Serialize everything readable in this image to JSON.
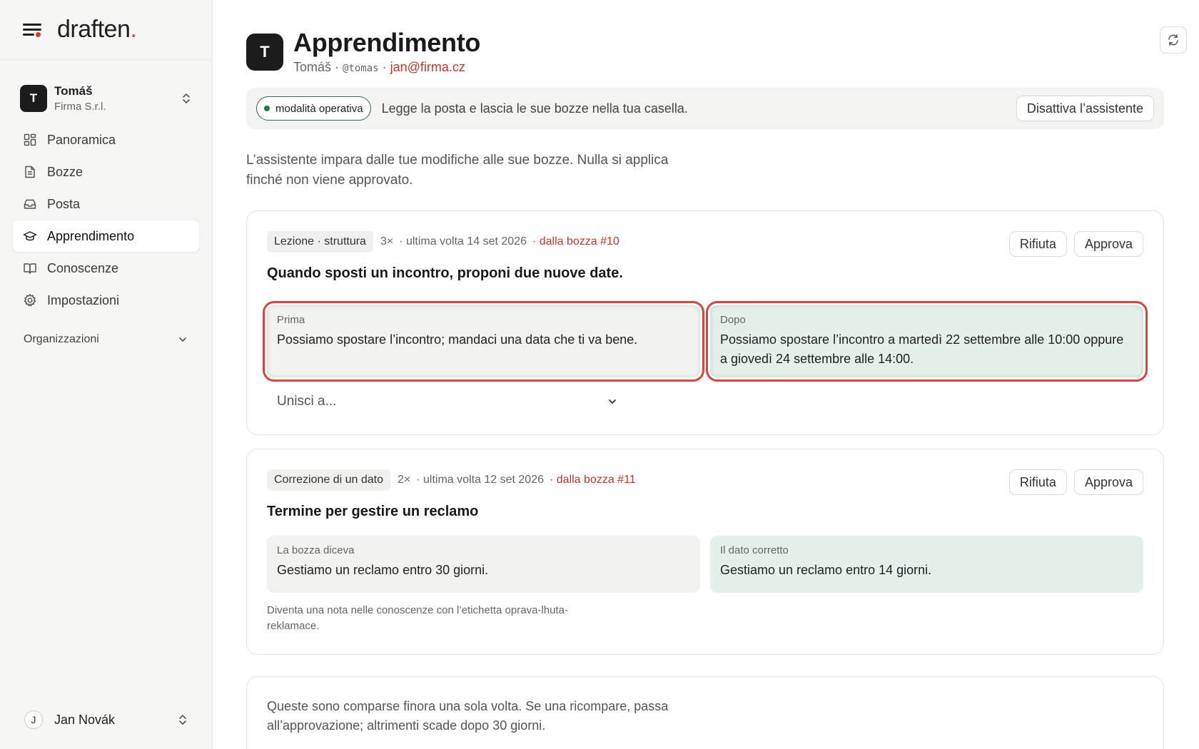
{
  "brand": {
    "logo_text": "draften",
    "logo_dot": "."
  },
  "account": {
    "initial": "T",
    "name": "Tomáš",
    "org": "Firma S.r.l."
  },
  "nav": {
    "items": [
      {
        "label": "Panoramica",
        "icon": "grid-icon"
      },
      {
        "label": "Bozze",
        "icon": "document-icon"
      },
      {
        "label": "Posta",
        "icon": "inbox-icon"
      },
      {
        "label": "Apprendimento",
        "icon": "graduation-cap-icon",
        "active": true
      },
      {
        "label": "Conoscenze",
        "icon": "book-icon"
      },
      {
        "label": "Impostazioni",
        "icon": "gear-icon"
      }
    ],
    "orgs_label": "Organizzazioni"
  },
  "user": {
    "initial": "J",
    "name": "Jan Novák"
  },
  "page": {
    "avatar_initial": "T",
    "title": "Apprendimento",
    "sub_name": "Tomáš · ",
    "sub_handle": "@tomas",
    "sub_sep": " · ",
    "sub_email": "jan@firma.cz"
  },
  "status": {
    "pill_label": "modalità operativa",
    "text": "Legge la posta e lascia le sue bozze nella tua casella.",
    "disable_button": "Disattiva l’assistente"
  },
  "intro": "L’assistente impara dalle tue modifiche alle sue bozze. Nulla si applica finché non viene approvato.",
  "cards": [
    {
      "tag": "Lezione · struttura",
      "count": "3×",
      "when": "· ultima volta 14 set 2026",
      "source": "· dalla bozza #10",
      "reject": "Rifiuta",
      "approve": "Approva",
      "title": "Quando sposti un incontro, proponi due nuove date.",
      "before_label": "Prima",
      "before_text": "Possiamo spostare l’incontro; mandaci una data che ti va bene.",
      "after_label": "Dopo",
      "after_text": "Possiamo spostare l’incontro a martedì 22 settembre alle 10:00 oppure a giovedì 24 settembre alle 14:00.",
      "merge_label": "Unisci a..."
    },
    {
      "tag": "Correzione di un dato",
      "count": "2×",
      "when": "· ultima volta 12 set 2026",
      "source": "· dalla bozza #11",
      "reject": "Rifiuta",
      "approve": "Approva",
      "title": "Termine per gestire un reclamo",
      "before_label": "La bozza diceva",
      "before_text": "Gestiamo un reclamo entro 30 giorni.",
      "after_label": "Il dato corretto",
      "after_text": "Gestiamo un reclamo entro 14 giorni.",
      "note": "Diventa una nota nelle conoscenze con l’etichetta oprava-lhuta-reklamace."
    }
  ],
  "pending": {
    "text": "Queste sono comparse finora una sola volta. Se una ricompare, passa all’approvazione; altrimenti scade dopo 30 giorni."
  }
}
